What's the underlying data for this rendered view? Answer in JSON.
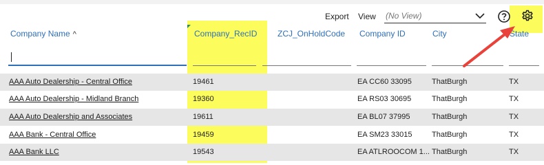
{
  "toolbar": {
    "export_label": "Export",
    "view_label": "View",
    "view_select_value": "(No View)"
  },
  "columns": [
    {
      "key": "company_name",
      "label": "Company Name",
      "sorted": "asc"
    },
    {
      "key": "company_recid",
      "label": "Company_RecID"
    },
    {
      "key": "zcj_onholdcode",
      "label": "ZCJ_OnHoldCode"
    },
    {
      "key": "company_id",
      "label": "Company ID"
    },
    {
      "key": "city",
      "label": "City"
    },
    {
      "key": "state",
      "label": "State"
    }
  ],
  "rows": [
    {
      "company_name": "AAA Auto Dealership - Central Office",
      "company_recid": "19461",
      "zcj_onholdcode": "",
      "company_id": "EA CC60 33095",
      "city": "ThatBurgh",
      "state": "TX"
    },
    {
      "company_name": "AAA Auto Dealership - Midland Branch",
      "company_recid": "19360",
      "zcj_onholdcode": "",
      "company_id": "EA RS03 30695",
      "city": "ThatBurgh",
      "state": "TX"
    },
    {
      "company_name": "AAA Auto Dealership and Associates",
      "company_recid": "19611",
      "zcj_onholdcode": "",
      "company_id": "EA BL07 37995",
      "city": "ThatBurgh",
      "state": "TX"
    },
    {
      "company_name": "AAA Bank - Central Office",
      "company_recid": "19459",
      "zcj_onholdcode": "",
      "company_id": "EA SM23 33015",
      "city": "ThatBurgh",
      "state": "TX"
    },
    {
      "company_name": "AAA Bank LLC",
      "company_recid": "19543",
      "zcj_onholdcode": "",
      "company_id": "EA ATLROOCOM 1...",
      "city": "ThatBurgh",
      "state": "TX"
    }
  ],
  "colors": {
    "highlight": "#fbfb3f",
    "header_text": "#2e6fb8",
    "annotation_arrow": "#e8423a"
  },
  "icons": {
    "sort": "arrow-up-icon",
    "view_dropdown": "chevron-down-icon",
    "help": "help-icon",
    "settings": "gear-icon"
  }
}
